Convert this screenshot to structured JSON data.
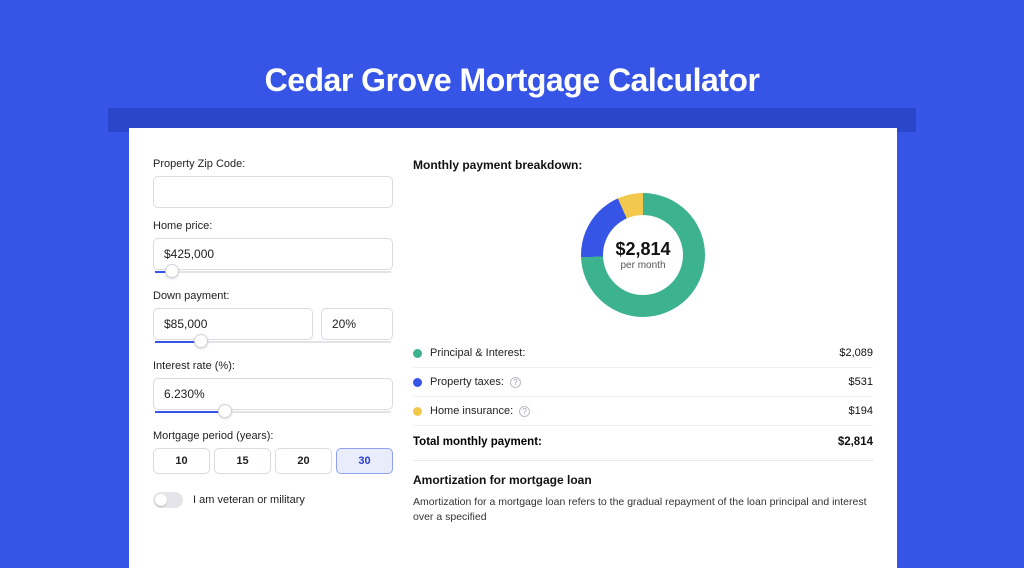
{
  "title": "Cedar Grove Mortgage Calculator",
  "colors": {
    "principal_interest": "#3cb28f",
    "property_taxes": "#3654e6",
    "home_insurance": "#f2c94c"
  },
  "form": {
    "zip": {
      "label": "Property Zip Code:",
      "value": ""
    },
    "home_price": {
      "label": "Home price:",
      "value": "$425,000",
      "slider_pct": 8
    },
    "down_payment": {
      "label": "Down payment:",
      "amount": "$85,000",
      "percent": "20%",
      "slider_pct": 20
    },
    "interest_rate": {
      "label": "Interest rate (%):",
      "value": "6.230%",
      "slider_pct": 30
    },
    "period": {
      "label": "Mortgage period (years):",
      "options": [
        "10",
        "15",
        "20",
        "30"
      ],
      "selected": "30"
    },
    "veteran": {
      "label": "I am veteran or military",
      "on": false
    }
  },
  "breakdown": {
    "title": "Monthly payment breakdown:",
    "center_amount": "$2,814",
    "center_sub": "per month",
    "items": [
      {
        "label": "Principal & Interest:",
        "value": "$2,089",
        "dot": "principal_interest",
        "info": false
      },
      {
        "label": "Property taxes:",
        "value": "$531",
        "dot": "property_taxes",
        "info": true
      },
      {
        "label": "Home insurance:",
        "value": "$194",
        "dot": "home_insurance",
        "info": true
      }
    ],
    "total_label": "Total monthly payment:",
    "total_value": "$2,814"
  },
  "chart_data": {
    "type": "pie",
    "title": "Monthly payment breakdown",
    "series": [
      {
        "name": "Principal & Interest",
        "value": 2089
      },
      {
        "name": "Property taxes",
        "value": 531
      },
      {
        "name": "Home insurance",
        "value": 194
      }
    ],
    "total": 2814,
    "unit": "$ / month"
  },
  "amortization": {
    "title": "Amortization for mortgage loan",
    "body": "Amortization for a mortgage loan refers to the gradual repayment of the loan principal and interest over a specified"
  }
}
